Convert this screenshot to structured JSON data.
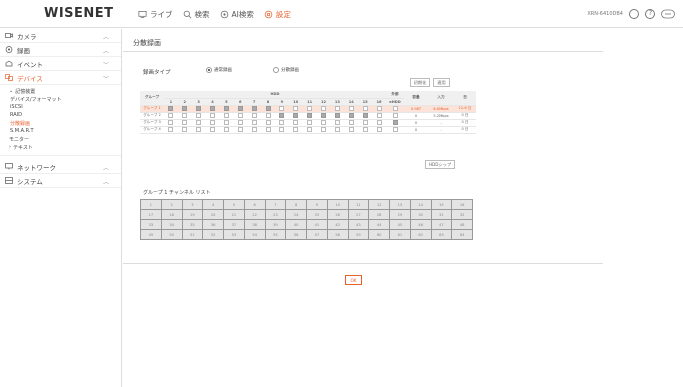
{
  "brand": {
    "logo": "WISENET",
    "accent": "#e8602c"
  },
  "nav": {
    "items": [
      {
        "label": "ライブ",
        "icon": "monitor-icon"
      },
      {
        "label": "検索",
        "icon": "search-icon"
      },
      {
        "label": "AI検索",
        "icon": "ai-search-icon"
      },
      {
        "label": "設定",
        "icon": "gear-icon",
        "active": true
      }
    ],
    "device_id": "XRN-6410DB4",
    "help": "?"
  },
  "sidebar": {
    "menus": [
      {
        "label": "カメラ",
        "icon": "camera-icon"
      },
      {
        "label": "録画",
        "icon": "record-icon"
      },
      {
        "label": "イベント",
        "icon": "event-icon"
      },
      {
        "label": "デバイス",
        "icon": "device-icon",
        "open": true
      }
    ],
    "device_items": [
      "記憶装置",
      "デバイス/フォーマット",
      "iSCSI",
      "RAID",
      "分散録画",
      "S.M.A.R.T",
      "モニター",
      "テキスト"
    ],
    "device_items_extra": [
      "記憶装置"
    ],
    "bottom_menus": [
      {
        "label": "ネットワーク",
        "icon": "network-icon"
      },
      {
        "label": "システム",
        "icon": "system-icon"
      }
    ]
  },
  "page": {
    "title": "分散録画",
    "record_type_label": "録画タイプ",
    "radio_normal": "通常録画",
    "radio_distributed": "分散録画",
    "btn_init": "初期化",
    "btn_apply": "適用",
    "btn_hdd_info": "HDDシップ",
    "channel_list_title": "グループ 1 チャンネル リスト",
    "ok": "OK"
  },
  "group_table": {
    "hdd_label": "HDD",
    "external_label": "外部",
    "group_col": "グループ",
    "eHDD": "eHDD",
    "capacity_col": "容量",
    "in_col": "入力",
    "days_col": "日",
    "hdd_numbers": [
      "1",
      "2",
      "3",
      "4",
      "5",
      "6",
      "7",
      "8",
      "9",
      "10",
      "11",
      "12",
      "13",
      "14",
      "15",
      "16"
    ],
    "rows": [
      {
        "group": "グループ 1",
        "checks": [
          1,
          1,
          1,
          1,
          1,
          1,
          1,
          1,
          0,
          0,
          0,
          0,
          0,
          0,
          0,
          0
        ],
        "ext": 0,
        "capacity": "0.98T",
        "input": "6.0Mbps",
        "days": "12.6 日",
        "selected": true
      },
      {
        "group": "グループ 2",
        "checks": [
          0,
          0,
          0,
          0,
          0,
          0,
          0,
          0,
          1,
          1,
          1,
          1,
          1,
          1,
          1,
          0
        ],
        "ext": 0,
        "capacity": "0",
        "input": "5.2Mbps",
        "days": "0 日"
      },
      {
        "group": "グループ 3",
        "checks": [
          0,
          0,
          0,
          0,
          0,
          0,
          0,
          0,
          0,
          0,
          0,
          0,
          0,
          0,
          0,
          0
        ],
        "ext": 1,
        "capacity": "0",
        "input": "-",
        "days": "0 日"
      },
      {
        "group": "グループ 4",
        "checks": [
          0,
          0,
          0,
          0,
          0,
          0,
          0,
          0,
          0,
          0,
          0,
          0,
          0,
          0,
          0,
          0
        ],
        "ext": 0,
        "capacity": "0",
        "input": "-",
        "days": "0 日"
      }
    ]
  },
  "channels": [
    [
      "1",
      "2",
      "3",
      "4",
      "5",
      "6",
      "7",
      "8",
      "9",
      "10",
      "11",
      "12",
      "13",
      "14",
      "15",
      "16"
    ],
    [
      "17",
      "18",
      "19",
      "20",
      "21",
      "22",
      "23",
      "24",
      "25",
      "26",
      "27",
      "28",
      "29",
      "30",
      "31",
      "32"
    ],
    [
      "33",
      "34",
      "35",
      "36",
      "37",
      "38",
      "39",
      "40",
      "41",
      "42",
      "43",
      "44",
      "45",
      "46",
      "47",
      "48"
    ],
    [
      "49",
      "50",
      "51",
      "52",
      "53",
      "54",
      "55",
      "56",
      "57",
      "58",
      "59",
      "60",
      "61",
      "62",
      "63",
      "64"
    ]
  ]
}
